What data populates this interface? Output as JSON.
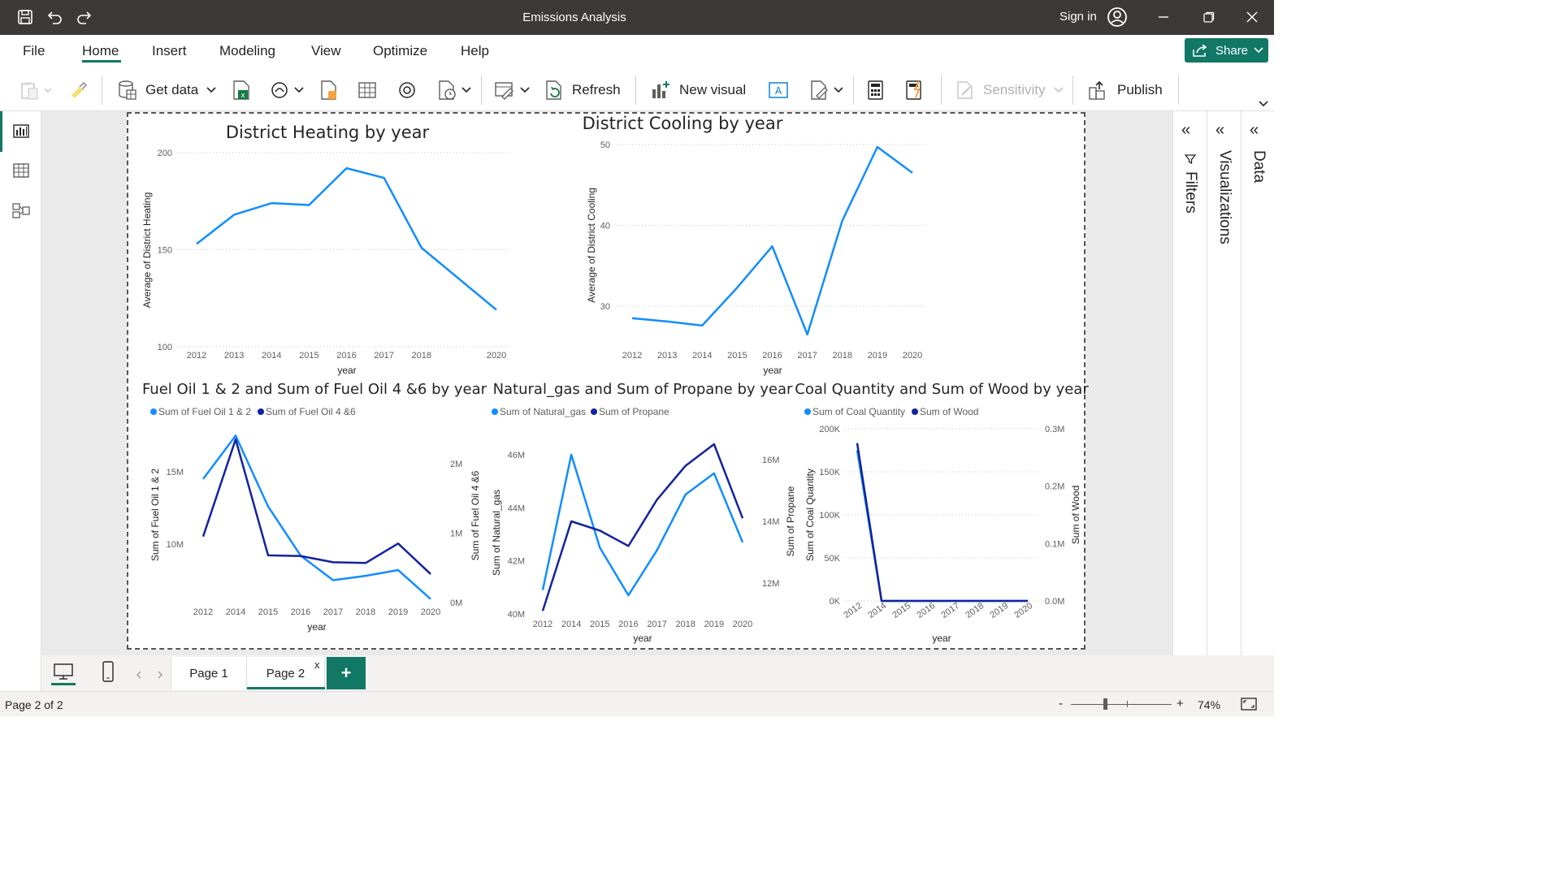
{
  "window": {
    "title": "Emissions Analysis",
    "sign_in": "Sign in"
  },
  "menu": {
    "items": [
      "File",
      "Home",
      "Insert",
      "Modeling",
      "View",
      "Optimize",
      "Help"
    ],
    "active": "Home",
    "share": "Share"
  },
  "ribbon": {
    "get_data": "Get data",
    "refresh": "Refresh",
    "new_visual": "New visual",
    "sensitivity": "Sensitivity",
    "publish": "Publish"
  },
  "panes": {
    "filters": "Filters",
    "visualizations": "Visualizations",
    "data": "Data"
  },
  "pages": {
    "tabs": [
      "Page 1",
      "Page 2"
    ],
    "active": "Page 2",
    "close_glyph": "x",
    "add": "+"
  },
  "status": {
    "page_indicator": "Page 2 of 2",
    "zoom": "74%",
    "minus": "-",
    "plus": "+"
  },
  "colors": {
    "accent": "#117865",
    "series_light": "#118DFF",
    "series_dark": "#12239E"
  },
  "chart_data": [
    {
      "type": "line",
      "title": "District Heating by year",
      "xlabel": "year",
      "ylabel": "Average of District Heating",
      "x": [
        2012,
        2013,
        2014,
        2015,
        2016,
        2017,
        2018,
        2019,
        2020
      ],
      "x_ticks": [
        "2012",
        "2013",
        "2014",
        "2015",
        "2016",
        "2017",
        "2018",
        "2020"
      ],
      "ylim": [
        100,
        200
      ],
      "y_ticks": [
        "200",
        "150",
        "100"
      ],
      "grid": true,
      "series": [
        {
          "values": [
            153,
            168,
            174,
            173,
            192,
            187,
            151,
            119
          ],
          "x": [
            2012,
            2013,
            2014,
            2015,
            2016,
            2017,
            2018,
            2020
          ]
        }
      ]
    },
    {
      "type": "line",
      "title": "District Cooling by year",
      "xlabel": "year",
      "ylabel": "Average of District Cooling",
      "x_ticks": [
        "2012",
        "2013",
        "2014",
        "2015",
        "2016",
        "2017",
        "2018",
        "2019",
        "2020"
      ],
      "ylim": [
        25,
        50
      ],
      "y_ticks": [
        "50",
        "40",
        "30"
      ],
      "grid": true,
      "series": [
        {
          "x": [
            2012,
            2013,
            2014,
            2015,
            2016,
            2017,
            2018,
            2019,
            2020
          ],
          "values": [
            28.5,
            28.1,
            27.6,
            32.3,
            37.4,
            26.5,
            40.6,
            49.7,
            46.5
          ]
        }
      ]
    },
    {
      "type": "line",
      "title": "Fuel Oil 1 & 2 and Sum of Fuel Oil 4 &6 by year",
      "xlabel": "year",
      "ylabel": "Sum of Fuel Oil 1 & 2",
      "y2label": "Sum of Fuel Oil 4 &6",
      "legend_position": "top-left",
      "x_ticks": [
        "2012",
        "2014",
        "2015",
        "2016",
        "2017",
        "2018",
        "2019",
        "2020"
      ],
      "y_ticks": [
        "15M",
        "10M"
      ],
      "y2_ticks": [
        "2M",
        "1M",
        "0M"
      ],
      "series": [
        {
          "name": "Sum of Fuel Oil 1 & 2",
          "axis": "left",
          "values": [
            14.5,
            17.5,
            12.6,
            9.2,
            7.5,
            7.8,
            8.2,
            6.2
          ]
        },
        {
          "name": "Sum of Fuel Oil 4 &6",
          "axis": "right",
          "values": [
            0.95,
            2.35,
            0.68,
            0.67,
            0.58,
            0.57,
            0.85,
            0.41
          ]
        }
      ]
    },
    {
      "type": "line",
      "title": "Natural_gas and Sum of Propane by year",
      "xlabel": "year",
      "ylabel": "Sum of Natural_gas",
      "y2label": "Sum of Propane",
      "legend_position": "top-left",
      "x_ticks": [
        "2012",
        "2014",
        "2015",
        "2016",
        "2017",
        "2018",
        "2019",
        "2020"
      ],
      "y_ticks": [
        "46M",
        "44M",
        "42M",
        "40M"
      ],
      "y2_ticks": [
        "16M",
        "14M",
        "12M"
      ],
      "series": [
        {
          "name": "Sum of Natural_gas",
          "axis": "left",
          "values": [
            40.9,
            46.0,
            42.5,
            40.7,
            42.4,
            44.5,
            45.3,
            42.7
          ]
        },
        {
          "name": "Sum of Propane",
          "axis": "right",
          "values": [
            11.1,
            14.0,
            13.7,
            13.2,
            14.7,
            15.8,
            16.5,
            14.1
          ]
        }
      ]
    },
    {
      "type": "line",
      "title": "Coal Quantity and Sum of Wood by year",
      "xlabel": "year",
      "ylabel": "Sum of Coal Quantity",
      "y2label": "Sum of Wood",
      "legend_position": "top-left",
      "x_ticks": [
        "2012",
        "2014",
        "2015",
        "2016",
        "2017",
        "2018",
        "2019",
        "2020"
      ],
      "y_ticks": [
        "200K",
        "150K",
        "100K",
        "50K",
        "0K"
      ],
      "y2_ticks": [
        "0.3M",
        "0.2M",
        "0.1M",
        "0.0M"
      ],
      "series": [
        {
          "name": "Sum of Coal Quantity",
          "axis": "left",
          "values": [
            175000,
            0,
            0,
            0,
            0,
            0,
            0,
            0
          ]
        },
        {
          "name": "Sum of Wood",
          "axis": "right",
          "values": [
            0.275,
            0,
            0,
            0,
            0,
            0,
            0,
            0
          ]
        }
      ]
    }
  ]
}
